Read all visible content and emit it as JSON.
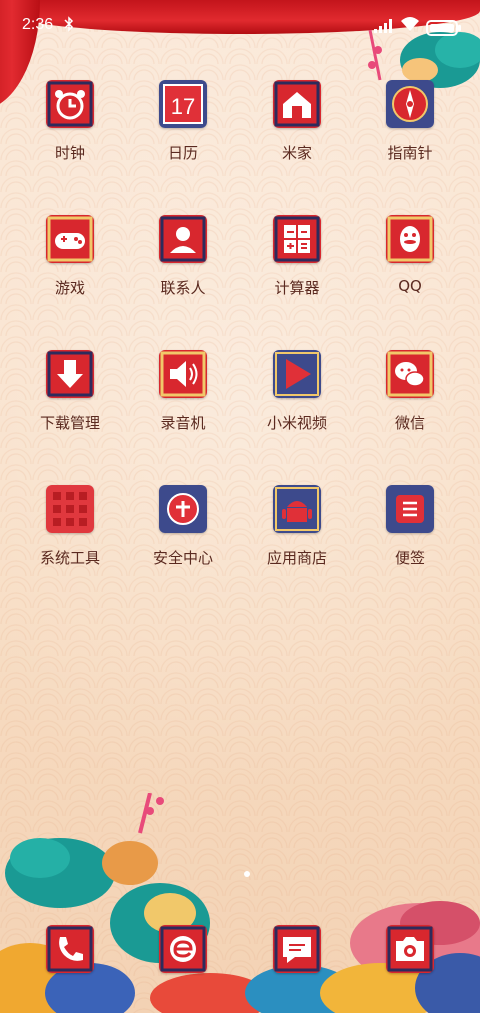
{
  "status_bar": {
    "time": "2:36"
  },
  "apps": [
    {
      "name": "app-clock",
      "label": "时钟",
      "icon": "alarm-clock-icon"
    },
    {
      "name": "app-calendar",
      "label": "日历",
      "icon": "calendar-icon",
      "badge_text": "17"
    },
    {
      "name": "app-mihome",
      "label": "米家",
      "icon": "home-icon"
    },
    {
      "name": "app-compass",
      "label": "指南针",
      "icon": "compass-icon"
    },
    {
      "name": "app-games",
      "label": "游戏",
      "icon": "gamepad-icon"
    },
    {
      "name": "app-contacts",
      "label": "联系人",
      "icon": "person-icon"
    },
    {
      "name": "app-calculator",
      "label": "计算器",
      "icon": "calculator-icon"
    },
    {
      "name": "app-qq",
      "label": "QQ",
      "icon": "penguin-icon"
    },
    {
      "name": "app-downloads",
      "label": "下载管理",
      "icon": "download-arrow-icon"
    },
    {
      "name": "app-recorder",
      "label": "录音机",
      "icon": "speaker-icon"
    },
    {
      "name": "app-mi-video",
      "label": "小米视频",
      "icon": "play-icon"
    },
    {
      "name": "app-wechat",
      "label": "微信",
      "icon": "chat-bubbles-icon"
    },
    {
      "name": "app-system-tools",
      "label": "系统工具",
      "icon": "folder-grid-icon"
    },
    {
      "name": "app-security",
      "label": "安全中心",
      "icon": "shield-icon"
    },
    {
      "name": "app-store",
      "label": "应用商店",
      "icon": "android-icon"
    },
    {
      "name": "app-notes",
      "label": "便签",
      "icon": "note-icon"
    }
  ],
  "dock": [
    {
      "name": "dock-phone",
      "icon": "phone-icon"
    },
    {
      "name": "dock-browser",
      "icon": "browser-e-icon"
    },
    {
      "name": "dock-messages",
      "icon": "message-bubble-icon"
    },
    {
      "name": "dock-camera",
      "icon": "camera-icon"
    }
  ],
  "colors": {
    "icon_red": "#d8272e",
    "icon_blue": "#3d4a8c",
    "label": "#5b2a20",
    "accent_teal": "#1aa39a"
  },
  "page_indicator": {
    "pages": 1,
    "current": 1
  }
}
